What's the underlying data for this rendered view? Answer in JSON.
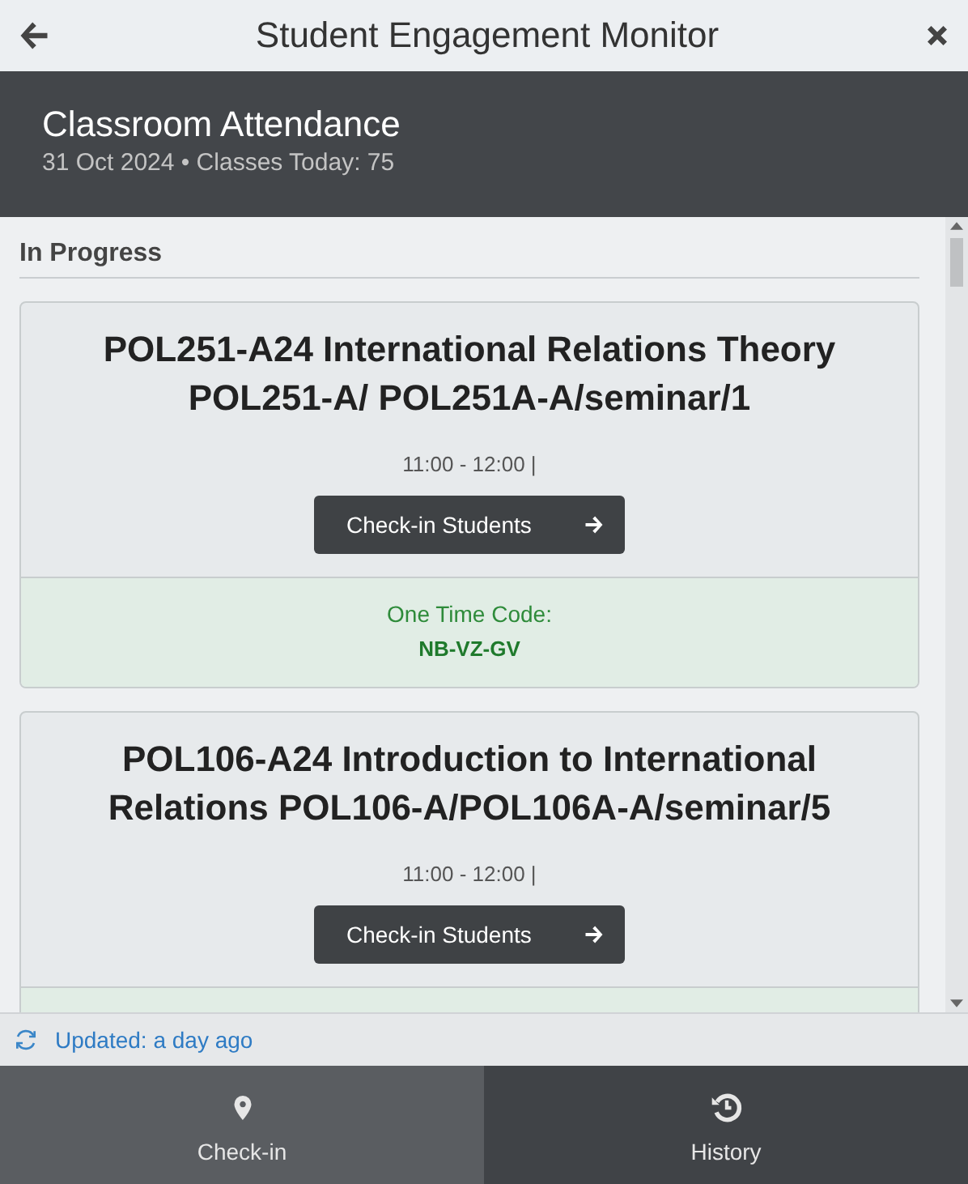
{
  "window": {
    "title": "Student Engagement Monitor"
  },
  "header": {
    "title": "Classroom Attendance",
    "subtitle": "31 Oct 2024 • Classes Today: 75"
  },
  "section": {
    "title": "In Progress"
  },
  "classes": [
    {
      "title": "POL251-A24 International Relations Theory POL251-A/ POL251A-A/seminar/1",
      "time": "11:00 - 12:00 |",
      "button": "Check-in Students",
      "code_label": "One Time Code:",
      "code": "NB-VZ-GV"
    },
    {
      "title": "POL106-A24 Introduction to International Relations POL106-A/POL106A-A/seminar/5",
      "time": "11:00 - 12:00 |",
      "button": "Check-in Students"
    }
  ],
  "status": {
    "text": "Updated: a day ago"
  },
  "nav": [
    {
      "label": "Check-in",
      "selected": true
    },
    {
      "label": "History",
      "selected": false
    }
  ]
}
